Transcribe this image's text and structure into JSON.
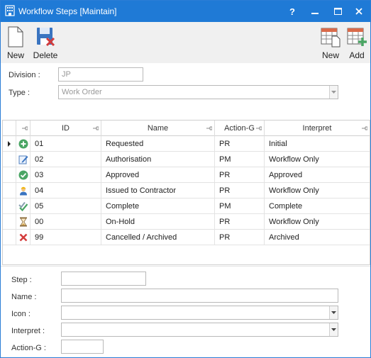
{
  "window": {
    "title": "Workflow Steps [Maintain]",
    "help_glyph": "?"
  },
  "toolbar": {
    "new_label": "New",
    "delete_label": "Delete",
    "grid_new_label": "New",
    "grid_add_label": "Add"
  },
  "header": {
    "division_label": "Division :",
    "division_value": "JP",
    "type_label": "Type :",
    "type_value": "Work Order"
  },
  "grid": {
    "columns": [
      "ID",
      "Name",
      "Action-G",
      "Interpret"
    ],
    "rows": [
      {
        "icon": "add-circle-icon",
        "id": "01",
        "name": "Requested",
        "action": "PR",
        "interpret": "Initial"
      },
      {
        "icon": "edit-icon",
        "id": "02",
        "name": "Authorisation",
        "action": "PM",
        "interpret": "Workflow Only"
      },
      {
        "icon": "check-circle-icon",
        "id": "03",
        "name": "Approved",
        "action": "PR",
        "interpret": "Approved"
      },
      {
        "icon": "contractor-icon",
        "id": "04",
        "name": "Issued to Contractor",
        "action": "PR",
        "interpret": "Workflow Only"
      },
      {
        "icon": "double-check-icon",
        "id": "05",
        "name": "Complete",
        "action": "PM",
        "interpret": "Complete"
      },
      {
        "icon": "hourglass-icon",
        "id": "00",
        "name": "On-Hold",
        "action": "PR",
        "interpret": "Workflow Only"
      },
      {
        "icon": "red-x-icon",
        "id": "99",
        "name": "Cancelled / Archived",
        "action": "PR",
        "interpret": "Archived"
      }
    ]
  },
  "form": {
    "step_label": "Step :",
    "name_label": "Name :",
    "icon_label": "Icon :",
    "interpret_label": "Interpret :",
    "action_label": "Action-G :",
    "step_value": "",
    "name_value": "",
    "icon_value": "",
    "interpret_value": "",
    "action_value": ""
  },
  "colors": {
    "titlebar": "#1f7ad6",
    "toolbar": "#f0f0f0",
    "delete_red": "#d33c3c",
    "green": "#4aa564"
  }
}
